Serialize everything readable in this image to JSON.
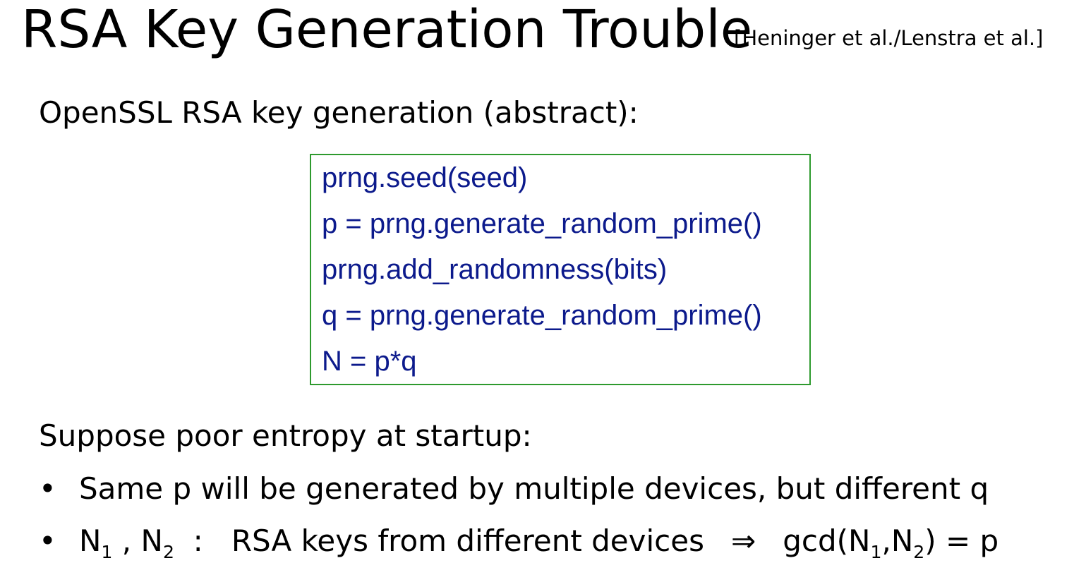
{
  "slide": {
    "title": "RSA Key Generation Trouble",
    "citation": "[Heninger et al./Lenstra et al.]",
    "intro": "OpenSSL RSA key generation  (abstract):",
    "code_lines": [
      "prng.seed(seed)",
      "p = prng.generate_random_prime()",
      "prng.add_randomness(bits)",
      "q = prng.generate_random_prime()",
      "N = p*q"
    ],
    "suppose": "Suppose poor entropy at startup:",
    "bullet_char": "•",
    "bullet1": "Same p will be generated by multiple devices, but different q",
    "bullet2": {
      "n": "N",
      "sub1": "1",
      "sep": " , ",
      "sub2": "2",
      "colon": "  :   ",
      "text": "RSA keys from different devices",
      "arrow": "⇒",
      "gcd_open": "gcd(",
      "comma": ",",
      "gcd_close": ") = p"
    }
  }
}
